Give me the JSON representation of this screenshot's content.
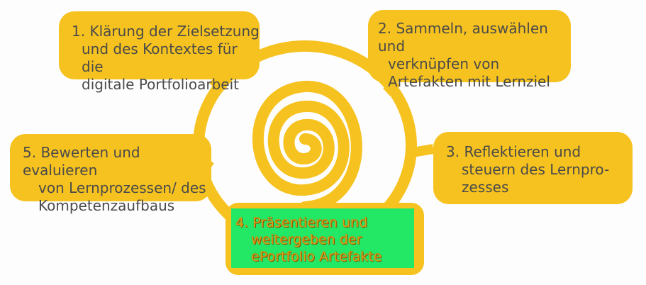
{
  "steps": [
    {
      "number": "1.",
      "lines": [
        "Klärung der Zielsetzung",
        "und des Kontextes für die",
        "digitale Portfolioarbeit"
      ]
    },
    {
      "number": "2.",
      "lines": [
        "Sammeln, auswählen und",
        "verknüpfen von",
        "Artefakten mit Lernziel"
      ]
    },
    {
      "number": "3.",
      "lines": [
        "Reflektieren und",
        "steuern des Lernpro-",
        "zesses"
      ]
    },
    {
      "number": "4.",
      "lines": [
        "Präsentieren und",
        "weitergeben der",
        "ePortfolio Artefakte"
      ]
    },
    {
      "number": "5.",
      "lines": [
        "Bewerten und evaluieren",
        "von Lernprozessen/ des",
        "Kompetenzaufbaus"
      ]
    }
  ],
  "colors": {
    "accent": "#f6c21f",
    "highlight": "#22e865",
    "text": "#4a4a4a"
  },
  "icons": [
    "spiral-icon"
  ]
}
